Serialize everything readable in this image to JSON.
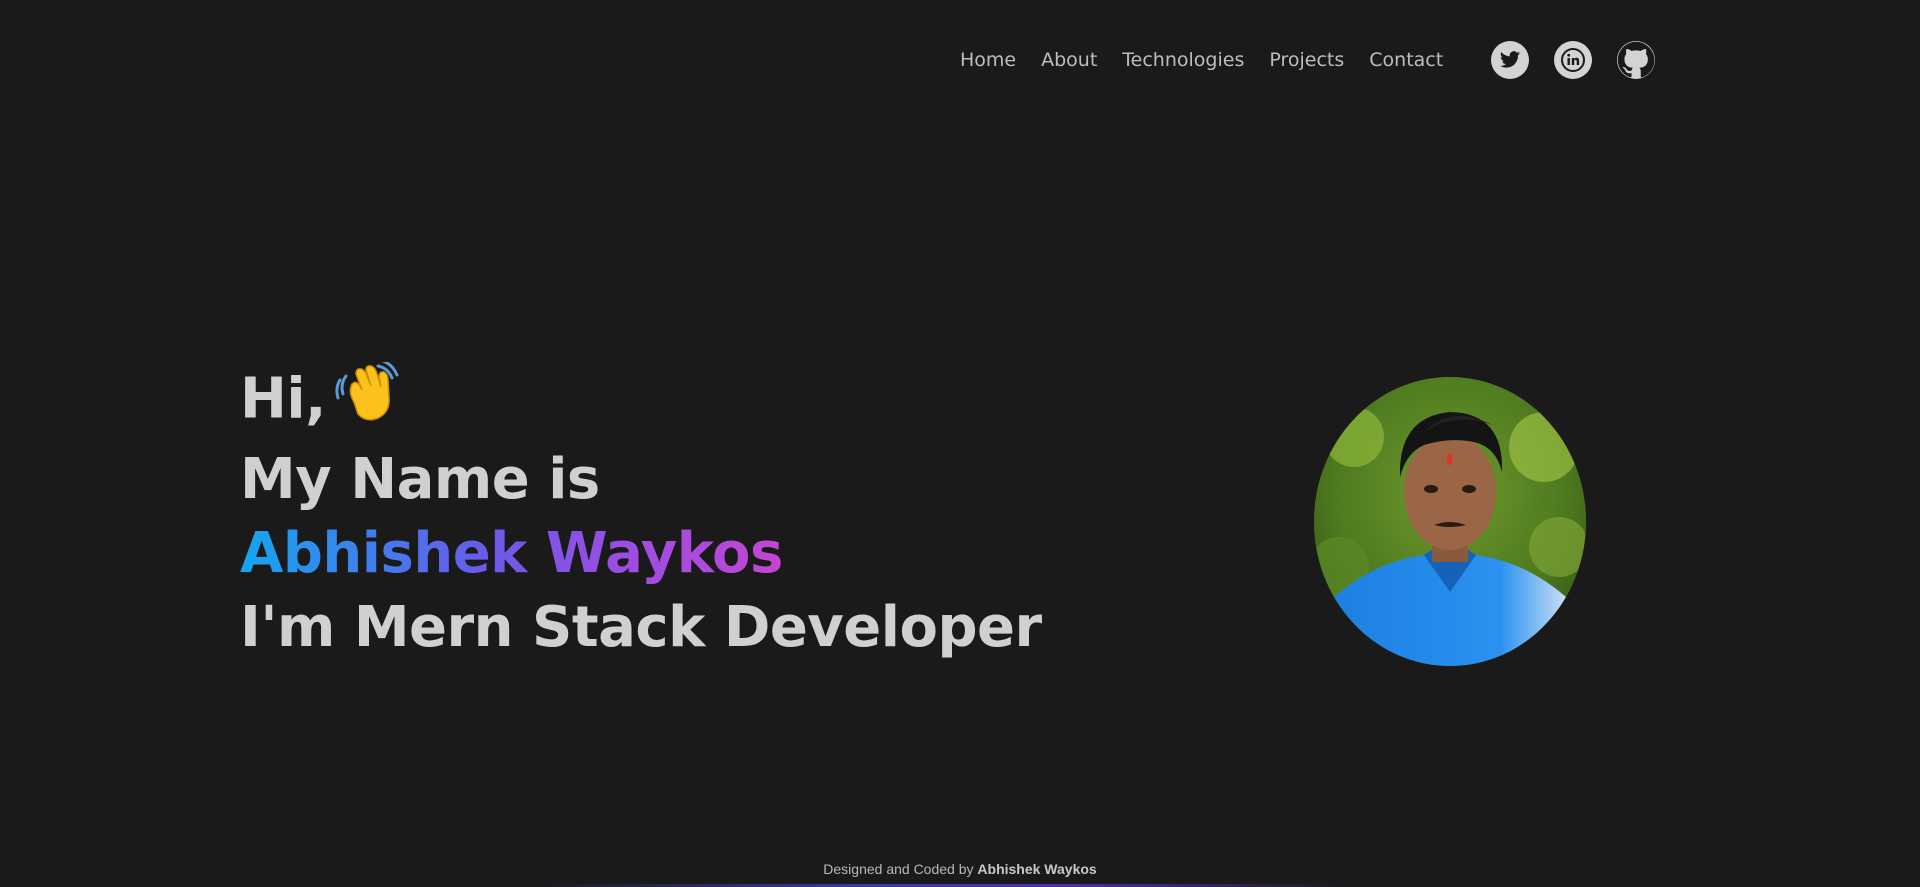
{
  "nav": {
    "items": [
      {
        "label": "Home"
      },
      {
        "label": "About"
      },
      {
        "label": "Technologies"
      },
      {
        "label": "Projects"
      },
      {
        "label": "Contact"
      }
    ]
  },
  "social": [
    {
      "icon": "twitter-icon"
    },
    {
      "icon": "linkedin-icon"
    },
    {
      "icon": "github-icon"
    }
  ],
  "hero": {
    "greeting": "Hi,",
    "wave_icon": "waving-hand-icon",
    "intro": "My Name is",
    "name": "Abhishek Waykos",
    "role": "I'm Mern Stack Developer"
  },
  "footer": {
    "prefix": "Designed and Coded by",
    "author": "Abhishek Waykos"
  },
  "colors": {
    "background": "#1a1a1a",
    "text": "#d0d0d0",
    "gradient_start": "#13a6f0",
    "gradient_end": "#c446d2"
  }
}
